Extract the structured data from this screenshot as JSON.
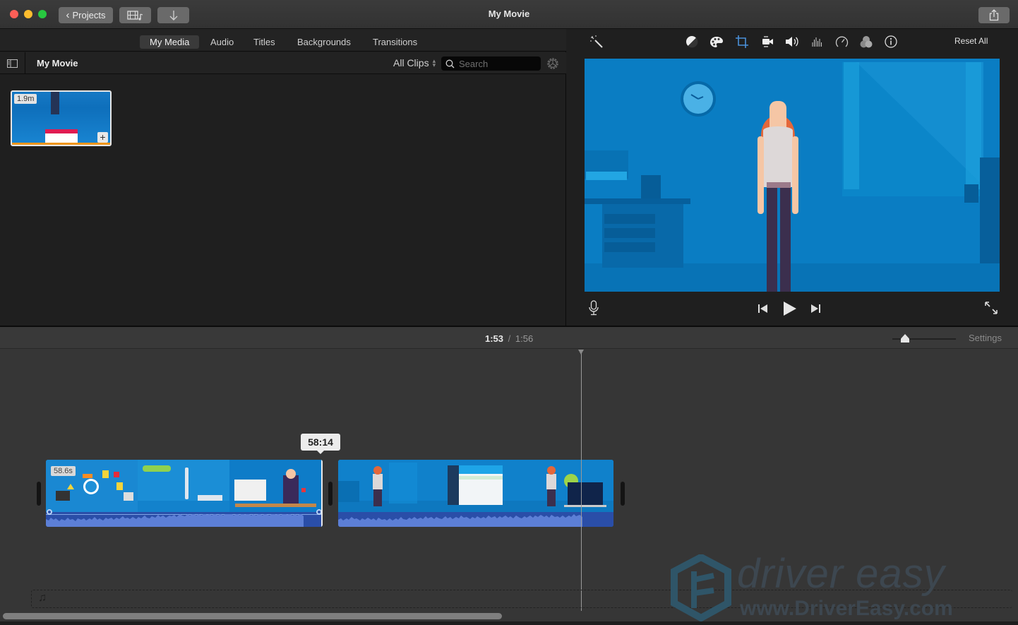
{
  "window": {
    "title": "My Movie"
  },
  "toolbar": {
    "projects_label": "Projects",
    "media_toggle_icon": "film-music-icon",
    "import_icon": "arrow-down-icon",
    "share_icon": "share-icon"
  },
  "browser": {
    "tabs": [
      {
        "label": "My Media",
        "active": true
      },
      {
        "label": "Audio",
        "active": false
      },
      {
        "label": "Titles",
        "active": false
      },
      {
        "label": "Backgrounds",
        "active": false
      },
      {
        "label": "Transitions",
        "active": false
      }
    ],
    "library_title": "My Movie",
    "filter_label": "All Clips",
    "search_placeholder": "Search",
    "clips": [
      {
        "duration": "1.9m"
      }
    ]
  },
  "viewer": {
    "tools": [
      "magic-wand-icon",
      "color-balance-icon",
      "color-correction-icon",
      "crop-icon",
      "stabilization-icon",
      "volume-icon",
      "equalizer-icon",
      "speed-icon",
      "clip-filter-icon",
      "info-icon"
    ],
    "reset_label": "Reset All",
    "active_tool": "crop-icon"
  },
  "timeline": {
    "current_time": "1:53",
    "separator": "/",
    "total_time": "1:56",
    "settings_label": "Settings",
    "zoom_level": 0.2,
    "clips": [
      {
        "duration": "58.6s"
      },
      {
        "duration": ""
      }
    ],
    "tooltip": "58:14",
    "scroll_position": 0.0
  },
  "watermark": {
    "line1": "driver easy",
    "line2": "www.DriverEasy.com"
  },
  "colors": {
    "accent": "#4a90d9",
    "clip_blue": "#1185d0",
    "audio_blue": "#2a4ea8"
  }
}
